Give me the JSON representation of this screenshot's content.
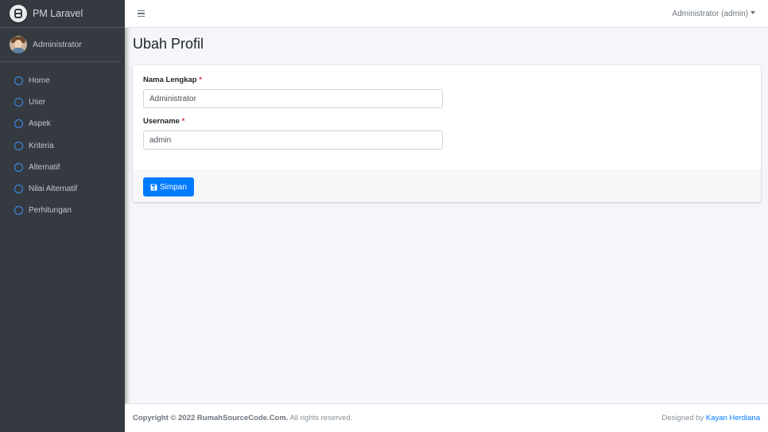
{
  "brand": {
    "name": "PM Laravel"
  },
  "user_panel": {
    "name": "Administrator"
  },
  "nav": {
    "items": [
      {
        "label": "Home"
      },
      {
        "label": "User"
      },
      {
        "label": "Aspek"
      },
      {
        "label": "Kriteria"
      },
      {
        "label": "Alternatif"
      },
      {
        "label": "Nilai Alternatif"
      },
      {
        "label": "Perhitungan"
      }
    ]
  },
  "topbar": {
    "user_menu": "Administrator (admin)"
  },
  "page": {
    "title": "Ubah Profil"
  },
  "form": {
    "nama_label": "Nama Lengkap",
    "nama_value": "Administrator",
    "username_label": "Username",
    "username_value": "admin",
    "required_mark": "*",
    "save_label": "Simpan"
  },
  "footer": {
    "copyright": "Copyright © 2022 RumahSourceCode.Com.",
    "rights": " All rights reserved.",
    "designed_by": "Designed by ",
    "author": "Kayan Herdiana"
  },
  "colors": {
    "sidebar": "#343a40",
    "accent": "#007bff",
    "nav_icon": "#3f8ff0",
    "required": "#dc3545"
  },
  "icons": {
    "brand": "brand-logo-icon",
    "nav": "circle-outline-icon",
    "menu": "hamburger-icon",
    "dropdown": "caret-down-icon",
    "save": "floppy-disk-icon"
  }
}
